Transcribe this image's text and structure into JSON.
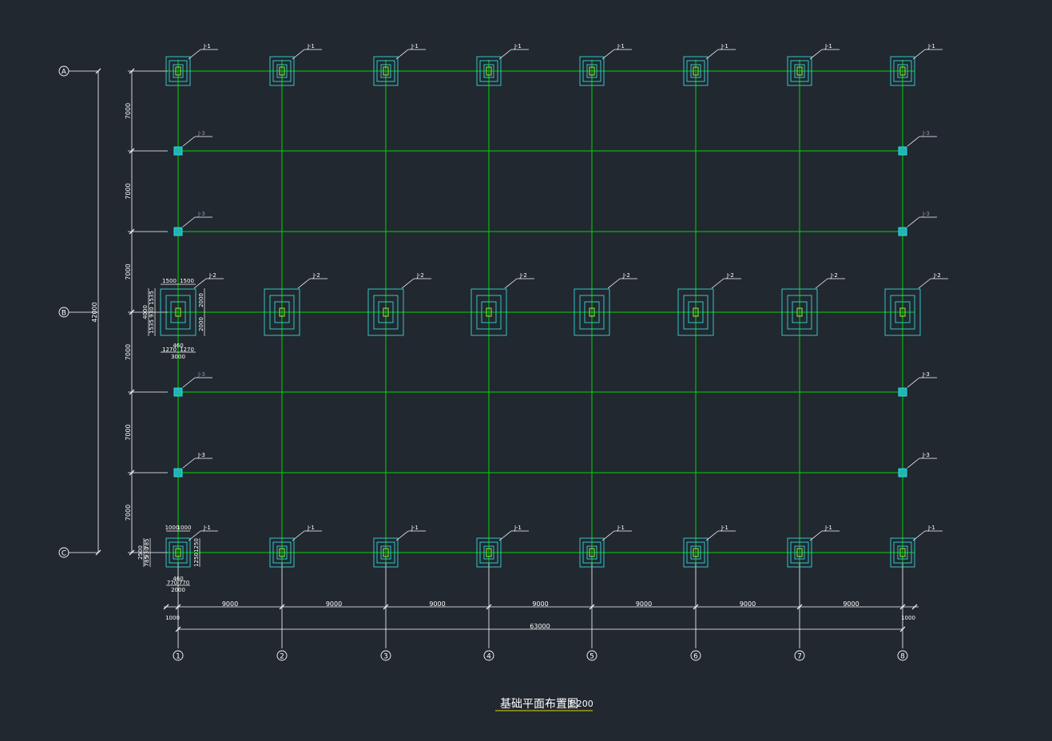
{
  "drawing": {
    "title": "基础平面布置图",
    "scale": "1:200"
  },
  "axes": {
    "columns": [
      "1",
      "2",
      "3",
      "4",
      "5",
      "6",
      "7",
      "8"
    ],
    "rows": [
      "A",
      "B",
      "C"
    ]
  },
  "dimensions": {
    "horizontal_spans": [
      "9000",
      "9000",
      "9000",
      "9000",
      "9000",
      "9000",
      "9000"
    ],
    "horizontal_total": "63000",
    "edge_left": "1000",
    "edge_right": "1000",
    "vertical_spans": [
      "7000",
      "7000",
      "7000",
      "7000",
      "7000",
      "7000"
    ],
    "vertical_total": "42000"
  },
  "footing_tags": {
    "j1": "J-1",
    "j2": "J-2",
    "j3": "J-3"
  },
  "detail_j2": {
    "top_left": "1500",
    "top_right": "1500",
    "right_top": "2000",
    "right_bottom": "2000",
    "left_total": "4000",
    "left_upper": "1535",
    "left_mid": "930",
    "left_lower": "1535",
    "bottom_col": "460",
    "bottom_left": "1270",
    "bottom_right": "1270",
    "bottom_total": "3000"
  },
  "detail_j1": {
    "top_left": "1000",
    "top_right": "1000",
    "right_top": "1250",
    "right_bottom": "1250",
    "left_total": "2500",
    "left_upper": "785",
    "left_mid": "930",
    "left_lower": "785",
    "bottom_col": "460",
    "bottom_left": "770",
    "bottom_right": "770",
    "bottom_total": "2000"
  },
  "colors": {
    "background": "#212830",
    "grid": "#00d900",
    "footing": "#36d6d6",
    "dimension": "#ffffff",
    "column": "#9ae64a",
    "title_underline": "#e6d600"
  }
}
